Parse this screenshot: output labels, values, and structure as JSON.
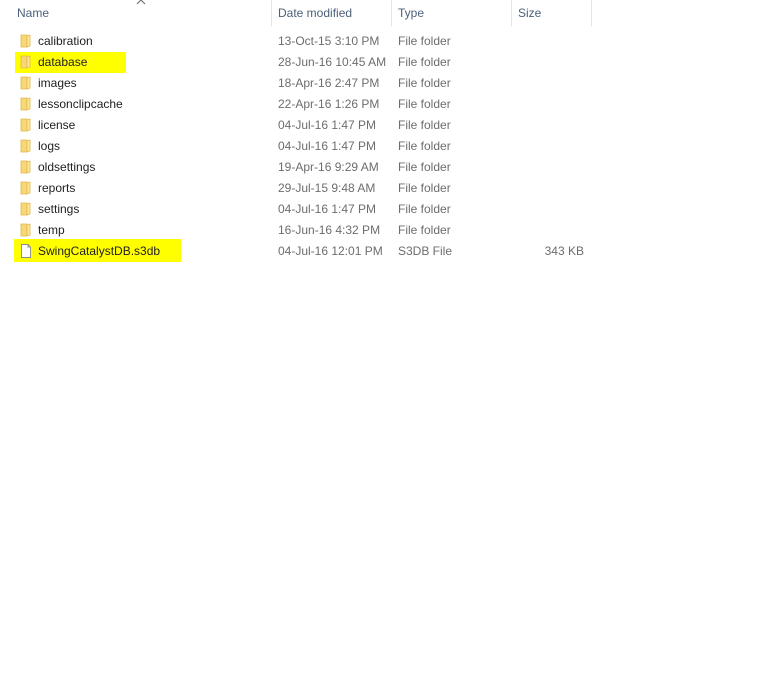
{
  "columns": {
    "name": "Name",
    "date_modified": "Date modified",
    "type": "Type",
    "size": "Size"
  },
  "sort": {
    "column": "name",
    "direction": "ascending",
    "icon": "chevron-up-icon"
  },
  "highlight_color": "#ffff00",
  "files": [
    {
      "name": "calibration",
      "date": "13-Oct-15 3:10 PM",
      "type": "File folder",
      "size": "",
      "icon": "folder-icon",
      "highlighted": false
    },
    {
      "name": "database",
      "date": "28-Jun-16 10:45 AM",
      "type": "File folder",
      "size": "",
      "icon": "folder-icon",
      "highlighted": true
    },
    {
      "name": "images",
      "date": "18-Apr-16 2:47 PM",
      "type": "File folder",
      "size": "",
      "icon": "folder-icon",
      "highlighted": false
    },
    {
      "name": "lessonclipcache",
      "date": "22-Apr-16 1:26 PM",
      "type": "File folder",
      "size": "",
      "icon": "folder-icon",
      "highlighted": false
    },
    {
      "name": "license",
      "date": "04-Jul-16 1:47 PM",
      "type": "File folder",
      "size": "",
      "icon": "folder-icon",
      "highlighted": false
    },
    {
      "name": "logs",
      "date": "04-Jul-16 1:47 PM",
      "type": "File folder",
      "size": "",
      "icon": "folder-icon",
      "highlighted": false
    },
    {
      "name": "oldsettings",
      "date": "19-Apr-16 9:29 AM",
      "type": "File folder",
      "size": "",
      "icon": "folder-icon",
      "highlighted": false
    },
    {
      "name": "reports",
      "date": "29-Jul-15 9:48 AM",
      "type": "File folder",
      "size": "",
      "icon": "folder-icon",
      "highlighted": false
    },
    {
      "name": "settings",
      "date": "04-Jul-16 1:47 PM",
      "type": "File folder",
      "size": "",
      "icon": "folder-icon",
      "highlighted": false
    },
    {
      "name": "temp",
      "date": "16-Jun-16 4:32 PM",
      "type": "File folder",
      "size": "",
      "icon": "folder-icon",
      "highlighted": false
    },
    {
      "name": "SwingCatalystDB.s3db",
      "date": "04-Jul-16 12:01 PM",
      "type": "S3DB File",
      "size": "343 KB",
      "icon": "file-icon",
      "highlighted": true
    }
  ]
}
